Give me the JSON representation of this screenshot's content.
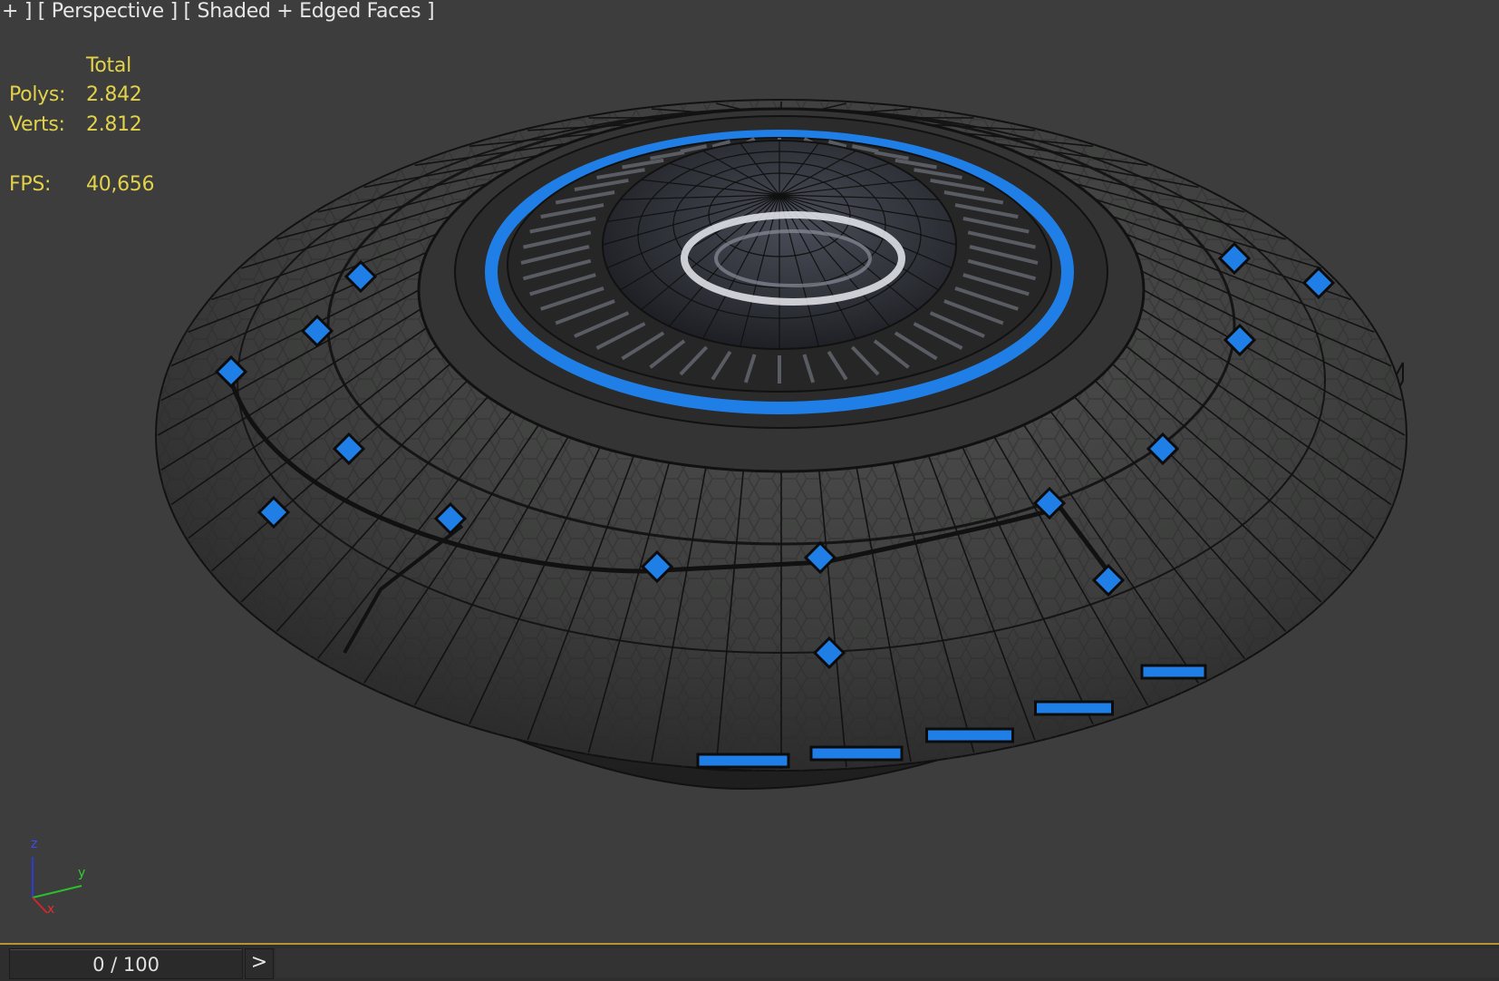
{
  "viewport": {
    "label": "+ ] [ Perspective ] [ Shaded + Edged Faces ]",
    "stats": {
      "header": "Total",
      "polys_label": "Polys:",
      "polys_value": "2.842",
      "verts_label": "Verts:",
      "verts_value": "2.812",
      "fps_label": "FPS:",
      "fps_value": "40,656"
    },
    "gizmo": {
      "z": "z",
      "y": "y",
      "x": "x"
    }
  },
  "timeline": {
    "frame_display": "0 / 100",
    "next_label": ">"
  },
  "colors": {
    "viewport_bg": "#3d3d3d",
    "stat_text": "#e2d24a",
    "accent_blue": "#1f7fe6",
    "timeline_border": "#b6962e"
  }
}
